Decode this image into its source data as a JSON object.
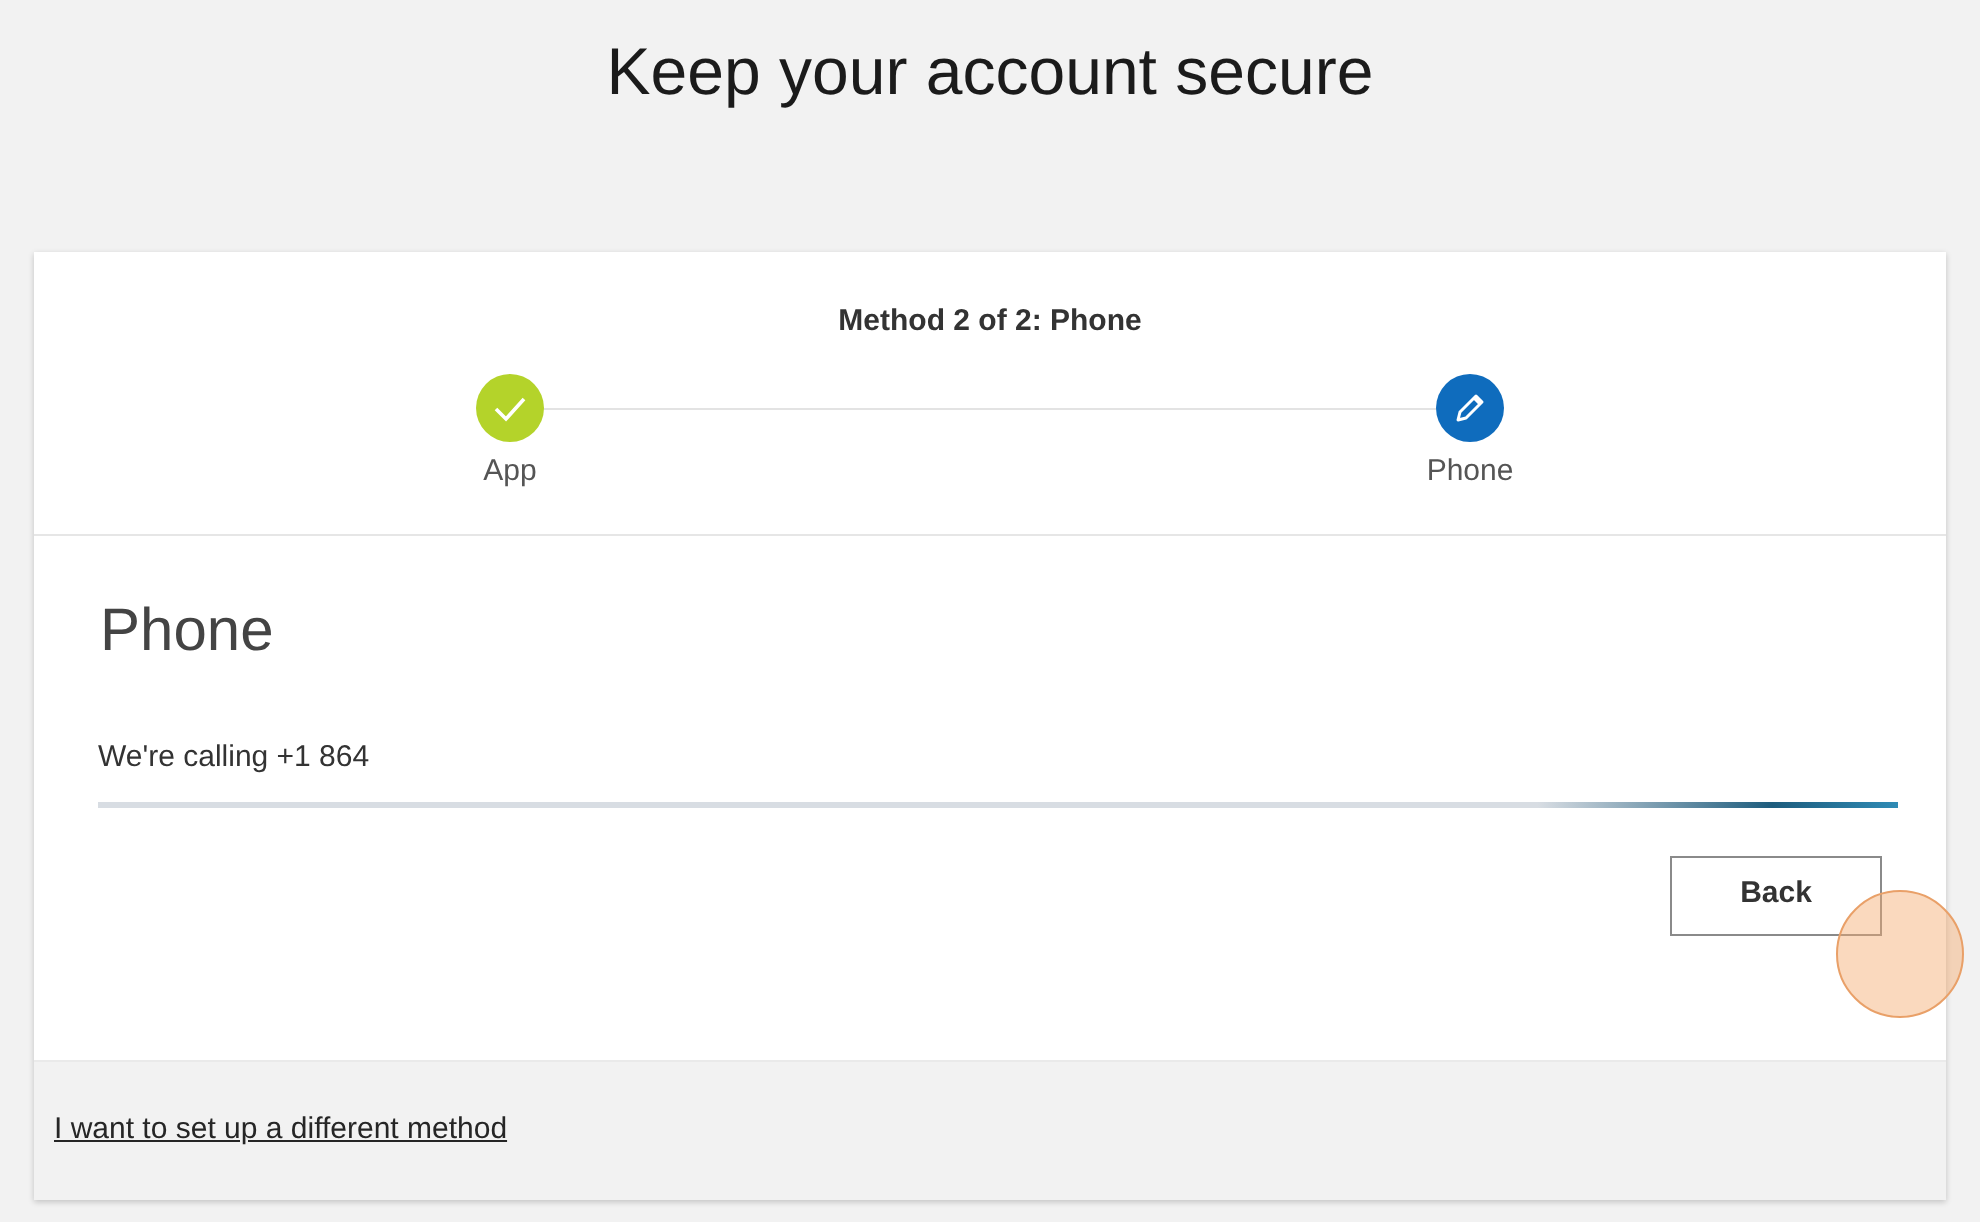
{
  "page_title": "Keep your account secure",
  "progress": {
    "caption": "Method 2 of 2: Phone",
    "steps": [
      {
        "label": "App",
        "kind": "done"
      },
      {
        "label": "Phone",
        "kind": "current"
      }
    ]
  },
  "section": {
    "heading": "Phone",
    "status": "We're calling +1 864"
  },
  "buttons": [
    {
      "label": "Back"
    }
  ],
  "footer_link": "I want to set up a different method"
}
